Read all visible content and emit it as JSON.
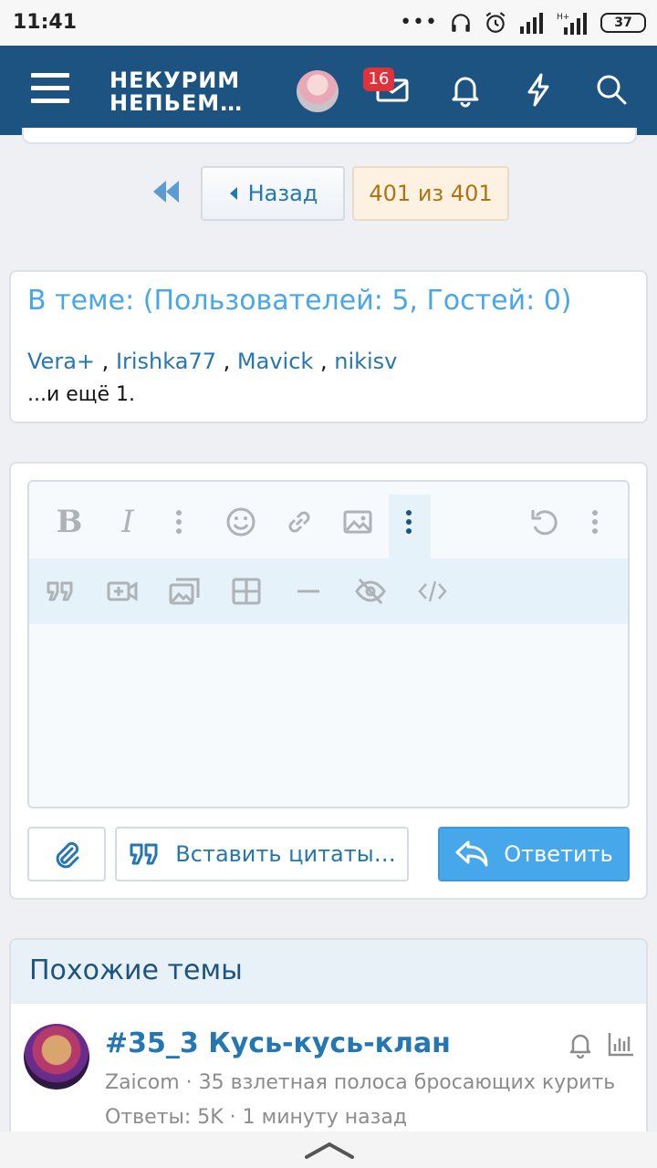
{
  "status_bar": {
    "time": "11:41",
    "battery": "37",
    "icons": [
      "dots-icon",
      "headphones-icon",
      "alarm-icon",
      "signal-icon",
      "signal-h-icon",
      "battery-icon"
    ]
  },
  "header": {
    "logo_line1": "НЕКУРИМ",
    "logo_line2": "НЕПЬЕМ…",
    "inbox_badge": "16",
    "icons": [
      "menu-icon",
      "avatar",
      "inbox-icon",
      "bell-icon",
      "lightning-icon",
      "search-icon"
    ]
  },
  "pager": {
    "back_label": "Назад",
    "position": "401 из 401"
  },
  "online": {
    "title": "В теме: (Пользователей: 5, Гостей: 0)",
    "users": [
      "Vera+",
      "Irishka77",
      "Mavick",
      "nikisv"
    ],
    "separator": ",",
    "more": "...и ещё 1."
  },
  "editor": {
    "toolbar_row1": [
      "bold",
      "italic",
      "more-vertical",
      "smiley",
      "link",
      "image",
      "more-vertical-active",
      "undo",
      "more-vertical"
    ],
    "toolbar_row2": [
      "quote",
      "video",
      "gallery",
      "table",
      "horizontal-rule",
      "spoiler",
      "code"
    ],
    "bold_glyph": "B",
    "italic_glyph": "I"
  },
  "actions": {
    "attach_icon": "paperclip-icon",
    "quote_label": "Вставить цитаты…",
    "reply_label": "Ответить"
  },
  "similar": {
    "title": "Похожие темы",
    "thread": {
      "title": "#35_3 Кусь-кусь-клан",
      "author": "Zaicom",
      "forum": "35 взлетная полоса бросающих курить",
      "meta_sep": "·",
      "replies": "Ответы: 5K",
      "time": "1 минуту назад"
    }
  },
  "colors": {
    "header": "#1d5380",
    "accent": "#47a7eb",
    "link": "#2577b1",
    "badge": "#e0323a"
  }
}
